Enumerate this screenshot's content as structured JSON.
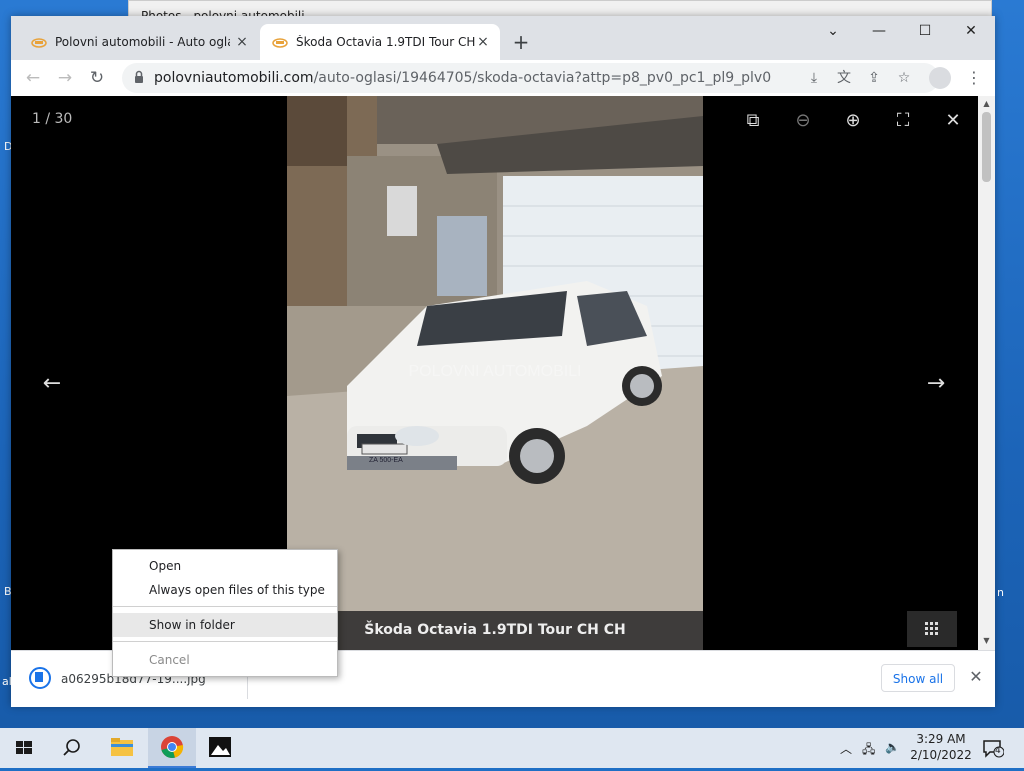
{
  "desktop": {
    "bg_window_title": "Photos - polovni automobili",
    "letters": [
      "D",
      "B",
      "n",
      "al"
    ]
  },
  "tabs": [
    {
      "title": "Polovni automobili - Auto oglasi",
      "close": "×"
    },
    {
      "title": "Škoda Octavia 1.9TDI Tour CH CH",
      "close": "×"
    }
  ],
  "new_tab": "+",
  "window_controls": {
    "minimize": "—",
    "maximize": "☐",
    "close": "✕",
    "search_tabs": "⌄"
  },
  "nav": {
    "back": "←",
    "forward": "→",
    "reload": "↻"
  },
  "address": {
    "host": "polovniautomobili.com",
    "path": "/auto-oglasi/19464705/skoda-octavia?attp=p8_pv0_pc1_pl9_plv0"
  },
  "viewer": {
    "counter": "1 / 30",
    "caption": "Škoda Octavia 1.9TDI Tour CH CH",
    "watermark": "POLOVNI AUTOMOBILI",
    "plate": "ZA 500-EA",
    "prev_arrow": "←",
    "next_arrow": "→",
    "close": "✕"
  },
  "download": {
    "filename": "a06295b18d77-19....jpg",
    "show_all": "Show all",
    "close": "✕",
    "chevron": "⌃"
  },
  "context_menu": {
    "items": [
      "Open",
      "Always open files of this type",
      "Show in folder",
      "Cancel"
    ],
    "highlighted": "Show in folder",
    "disabled": "Cancel"
  },
  "taskbar": {
    "time": "3:29 AM",
    "date": "2/10/2022",
    "notifications": "4"
  }
}
